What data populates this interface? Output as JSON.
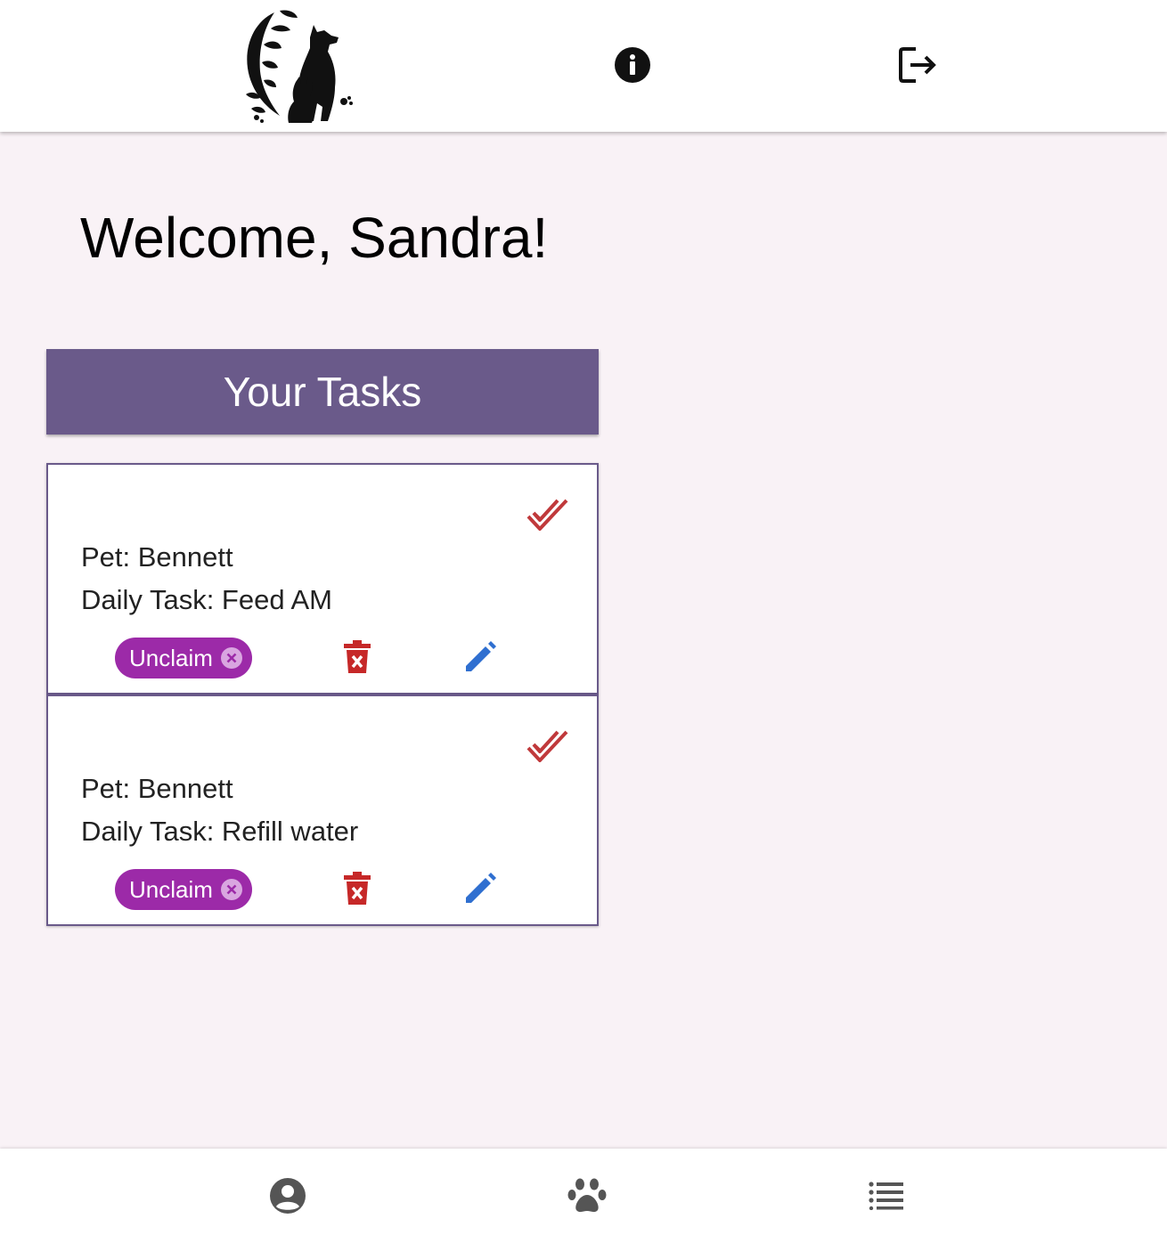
{
  "header": {
    "logo_icon": "cat-dog-silhouette-logo",
    "info_icon": "info-circle-icon",
    "logout_icon": "logout-icon"
  },
  "main": {
    "welcome_text": "Welcome, Sandra!",
    "tasks_title": "Your Tasks",
    "tasks": [
      {
        "pet": "Pet: Bennett",
        "task": "Daily Task: Feed AM",
        "unclaim_label": "Unclaim"
      },
      {
        "pet": "Pet: Bennett",
        "task": "Daily Task: Refill water",
        "unclaim_label": "Unclaim"
      }
    ]
  },
  "bottom_nav": {
    "items": [
      {
        "icon": "account-circle-icon"
      },
      {
        "icon": "paw-icon"
      },
      {
        "icon": "list-icon"
      }
    ]
  },
  "colors": {
    "background": "#f9f2f6",
    "accent_purple": "#6a5a8a",
    "chip_purple": "#9c2aa8",
    "delete_red": "#c62828",
    "check_red": "#c0393b",
    "edit_blue": "#2f6fd0"
  }
}
